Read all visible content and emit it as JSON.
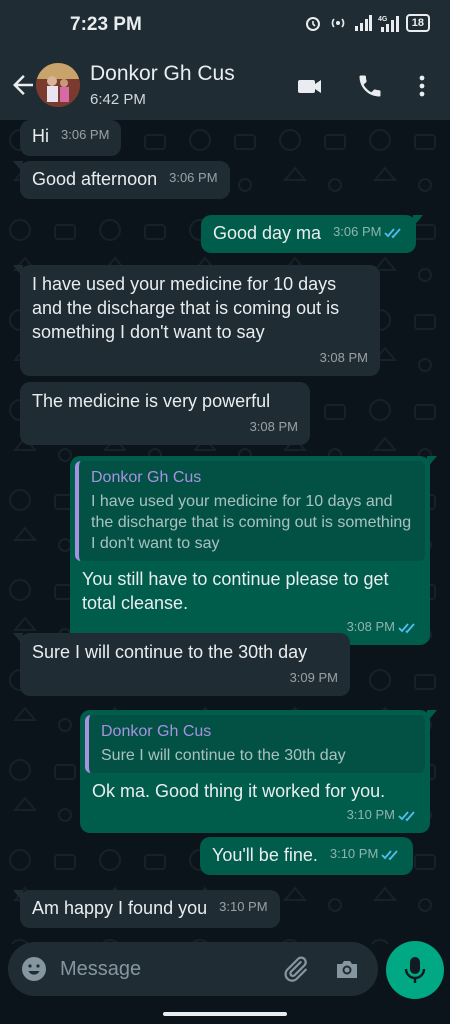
{
  "status": {
    "time": "7:23 PM",
    "battery": "18"
  },
  "header": {
    "name": "Donkor Gh Cus",
    "subtitle": "6:42 PM"
  },
  "messages": [
    {
      "text": "Hi",
      "time": "3:06 PM"
    },
    {
      "text": "Good afternoon",
      "time": "3:06 PM"
    },
    {
      "text": "Good day ma",
      "time": "3:06 PM"
    },
    {
      "text": "I have used your medicine for 10 days and the discharge that is coming out is something I don't want to say",
      "time": "3:08 PM"
    },
    {
      "text": "The medicine is very powerful",
      "time": "3:08 PM"
    },
    {
      "quote_name": "Donkor Gh Cus",
      "quote_text": "I have used your medicine for 10 days and the discharge that is coming out is something I don't want to say",
      "text": "You still have to continue please to get total cleanse.",
      "time": "3:08 PM"
    },
    {
      "text": "Sure I will continue to the 30th day",
      "time": "3:09 PM"
    },
    {
      "quote_name": "Donkor Gh Cus",
      "quote_text": "Sure I will continue to the 30th day",
      "text": "Ok ma. Good thing it worked for you.",
      "time": "3:10 PM"
    },
    {
      "text": "You'll be fine.",
      "time": "3:10 PM"
    },
    {
      "text": "Am happy I found you",
      "time": "3:10 PM"
    }
  ],
  "composer": {
    "placeholder": "Message"
  },
  "colors": {
    "incoming": "#202c33",
    "outgoing": "#005c4b",
    "accent": "#00a884",
    "quote_name": "#a693e0",
    "tick_read": "#53bdeb"
  },
  "icons": [
    "back-arrow-icon",
    "video-call-icon",
    "phone-icon",
    "more-vert-icon",
    "emoji-icon",
    "attach-icon",
    "camera-icon",
    "mic-icon",
    "double-tick-icon"
  ]
}
